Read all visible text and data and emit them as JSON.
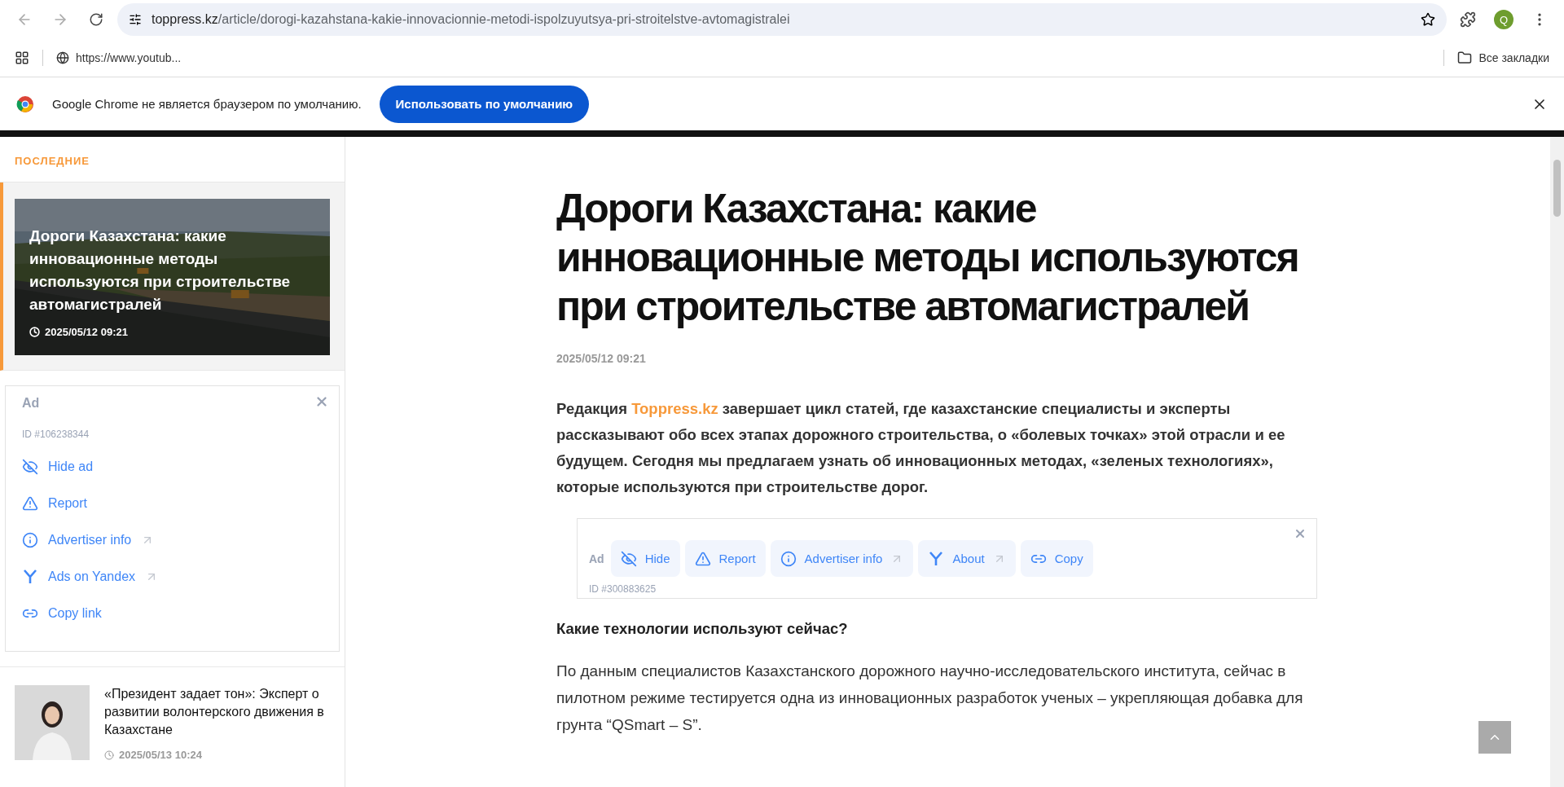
{
  "browser": {
    "url_host": "toppress.kz",
    "url_path": "/article/dorogi-kazahstana-kakie-innovacionnie-metodi-ispolzuyutsya-pri-stroitelstve-avtomagistralei",
    "profile_initial": "Q",
    "bookmarks": [
      {
        "label": "https://www.youtub..."
      }
    ],
    "all_bookmarks": "Все закладки"
  },
  "infobar": {
    "message": "Google Chrome не является браузером по умолчанию.",
    "button": "Использовать по умолчанию"
  },
  "sidebar": {
    "heading": "ПОСЛЕДНИЕ",
    "featured": {
      "title": "Дороги Казахстана: какие инновационные методы используются при строительстве автомагистралей",
      "date": "2025/05/12 09:21",
      "selected": true
    },
    "ad": {
      "label": "Ad",
      "id": "ID #106238344",
      "items": [
        {
          "kind": "hide",
          "label": "Hide ad",
          "external": false
        },
        {
          "kind": "report",
          "label": "Report",
          "external": false
        },
        {
          "kind": "info",
          "label": "Advertiser info",
          "external": true
        },
        {
          "kind": "yandex",
          "label": "Ads on Yandex",
          "external": true
        },
        {
          "kind": "link",
          "label": "Copy link",
          "external": false
        }
      ]
    },
    "news": [
      {
        "title": "«Президент задает тон»: Эксперт о развитии волонтерского движения в Казахстане",
        "date": "2025/05/13 10:24"
      }
    ]
  },
  "article": {
    "title": "Дороги Казахстана: какие инновационные методы используются при строительстве автомагистралей",
    "date": "2025/05/12 09:21",
    "lead_before": "Редакция ",
    "lead_link": "Toppress.kz",
    "lead_after": " завершает цикл статей, где казахстанские специалисты и эксперты рассказывают обо всех этапах дорожного строительства, о «болевых точках» этой отрасли и ее будущем. Сегодня мы предлагаем узнать об инновационных методах, «зеленых технологиях», которые используются при строительстве дорог.",
    "ad": {
      "label": "Ad",
      "id": "ID #300883625",
      "items": [
        {
          "kind": "hide",
          "label": "Hide",
          "external": false
        },
        {
          "kind": "report",
          "label": "Report",
          "external": false
        },
        {
          "kind": "info",
          "label": "Advertiser info",
          "external": true
        },
        {
          "kind": "yandex",
          "label": "About",
          "external": true
        },
        {
          "kind": "link",
          "label": "Copy",
          "external": false
        }
      ]
    },
    "heading": "Какие технологии используют сейчас?",
    "paragraph": "По данным специалистов Казахстанского дорожного научно-исследовательского института, сейчас в пилотном режиме тестируется одна из инновационных разработок ученых – укрепляющая добавка для грунта “QSmart – S”."
  }
}
